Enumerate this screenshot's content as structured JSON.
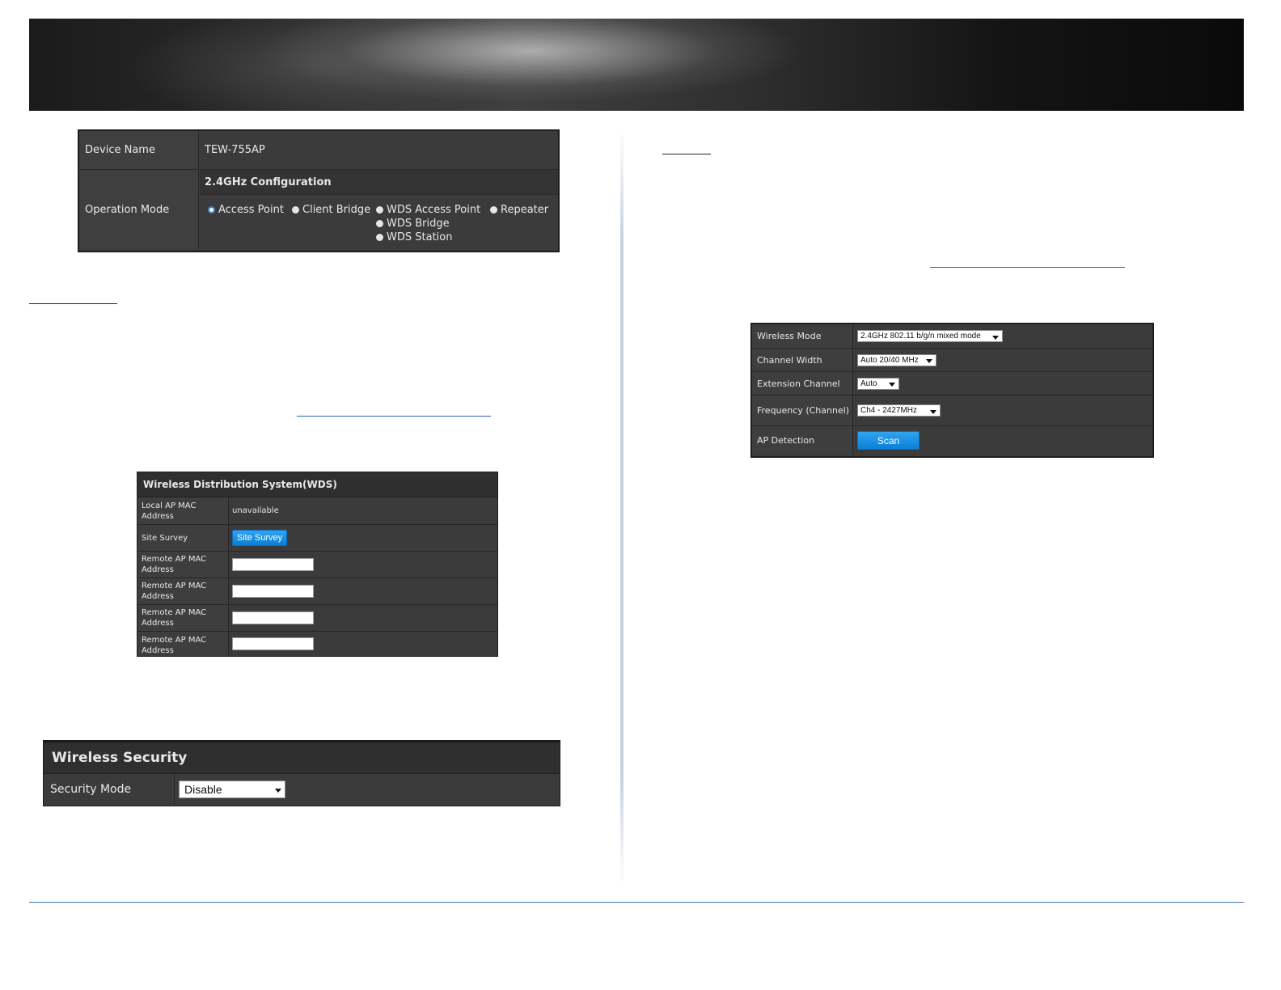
{
  "operation_panel": {
    "device_name_label": "Device Name",
    "device_name_value": "TEW-755AP",
    "operation_mode_label": "Operation Mode",
    "config_heading": "2.4GHz Configuration",
    "modes": [
      "Access Point",
      "Client Bridge",
      "WDS Access Point",
      "Repeater",
      "WDS Bridge",
      "WDS Station"
    ],
    "selected_mode": "Access Point"
  },
  "wds_panel": {
    "title": "Wireless Distribution System(WDS)",
    "local_mac_label": "Local AP MAC Address",
    "local_mac_value": "unavailable",
    "site_survey_label": "Site Survey",
    "site_survey_button": "Site Survey",
    "remote_mac_label": "Remote AP MAC Address",
    "remote_mac_values": [
      "",
      "",
      "",
      ""
    ]
  },
  "security_panel": {
    "title": "Wireless Security",
    "mode_label": "Security Mode",
    "mode_value": "Disable"
  },
  "wireless_panel": {
    "wireless_mode_label": "Wireless Mode",
    "wireless_mode_value": "2.4GHz 802.11 b/g/n mixed mode",
    "channel_width_label": "Channel Width",
    "channel_width_value": "Auto 20/40 MHz",
    "extension_channel_label": "Extension Channel",
    "extension_channel_value": "Auto",
    "frequency_label": "Frequency (Channel)",
    "frequency_value": "Ch4 - 2427MHz",
    "ap_detection_label": "AP Detection",
    "scan_button": "Scan"
  },
  "colors": {
    "panel_bg": "#3b3b3b",
    "accent_blue": "#0a7fd6",
    "footer_line": "#3d7ab8"
  }
}
